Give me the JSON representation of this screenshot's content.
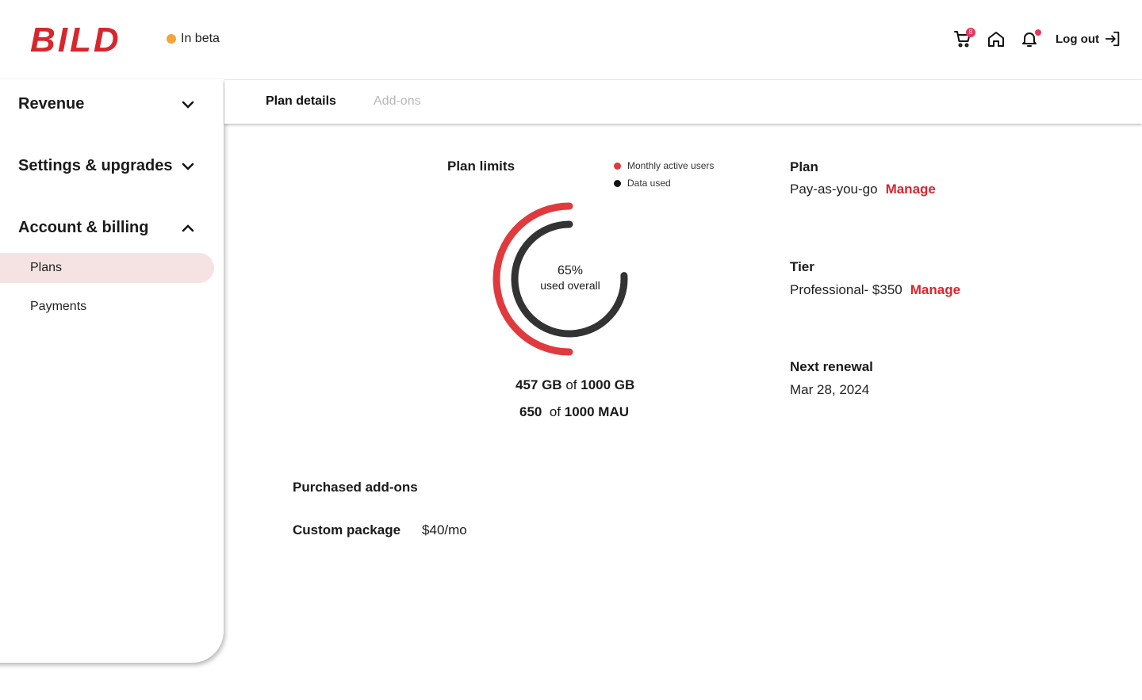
{
  "brand": {
    "name": "BILD",
    "color": "#d8262d"
  },
  "header": {
    "beta_label": "In beta",
    "cart_badge": "8",
    "logout_label": "Log out"
  },
  "sidebar": {
    "sections": [
      {
        "label": "Revenue",
        "expanded": false
      },
      {
        "label": "Settings & upgrades",
        "expanded": false
      },
      {
        "label": "Account & billing",
        "expanded": true
      }
    ],
    "sub_items": [
      {
        "label": "Plans",
        "active": true
      },
      {
        "label": "Payments",
        "active": false
      }
    ]
  },
  "tabs": [
    {
      "label": "Plan details",
      "active": true
    },
    {
      "label": "Add-ons",
      "active": false
    }
  ],
  "plan_limits": {
    "title": "Plan limits",
    "legend": [
      {
        "label": "Monthly active users",
        "color": "#e03a3e"
      },
      {
        "label": "Data used",
        "color": "#111111"
      }
    ],
    "overall_percent": "65%",
    "overall_label": "used overall",
    "data_used": "457 GB",
    "data_of": "of",
    "data_total": "1000 GB",
    "mau_used": "650",
    "mau_of": "of",
    "mau_total": "1000 MAU"
  },
  "chart_data": {
    "type": "pie",
    "title": "Plan limits",
    "series": [
      {
        "name": "Monthly active users",
        "value": 0.5,
        "color": "#e03a3e"
      },
      {
        "name": "Data used",
        "value": 0.76,
        "color": "#333333"
      }
    ],
    "center_text": [
      "65%",
      "used overall"
    ]
  },
  "plan": {
    "label": "Plan",
    "value": "Pay-as-you-go",
    "action": "Manage"
  },
  "tier": {
    "label": "Tier",
    "value": "Professional- $350",
    "action": "Manage"
  },
  "renewal": {
    "label": "Next renewal",
    "value": "Mar 28, 2024"
  },
  "addons": {
    "title": "Purchased add-ons",
    "items": [
      {
        "name": "Custom package",
        "price": "$40/mo"
      }
    ]
  }
}
